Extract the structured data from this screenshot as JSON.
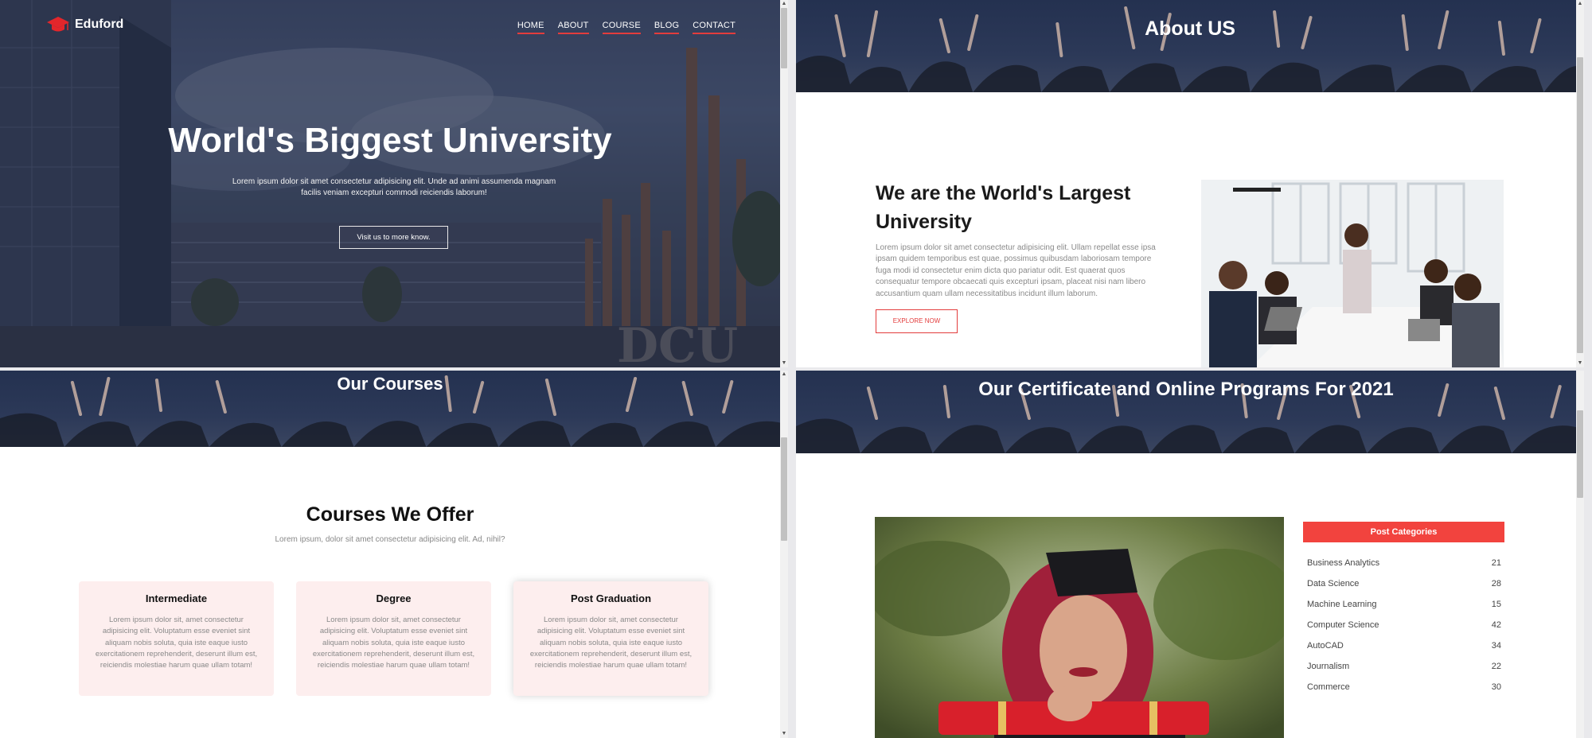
{
  "hero": {
    "brand": "Eduford",
    "nav": [
      "HOME",
      "ABOUT",
      "COURSE",
      "BLOG",
      "CONTACT"
    ],
    "title": "World's Biggest University",
    "text": "Lorem ipsum dolor sit amet consectetur adipisicing elit. Unde ad animi assumenda magnam facilis veniam excepturi commodi reiciendis laborum!",
    "button": "Visit us to more know."
  },
  "about": {
    "banner_title": "About US",
    "heading": "We are the World's Largest University",
    "paragraph": "Lorem ipsum dolor sit amet consectetur adipisicing elit. Ullam repellat esse ipsa ipsam quidem temporibus est quae, possimus quibusdam laboriosam tempore fuga modi id consectetur enim dicta quo pariatur odit. Est quaerat quos consequatur tempore obcaecati quis excepturi ipsam, placeat nisi nam libero accusantium quam ullam necessitatibus incidunt illum laborum.",
    "button": "EXPLORE NOW"
  },
  "courses": {
    "banner_title": "Our Courses",
    "heading": "Courses We Offer",
    "subtitle": "Lorem ipsum, dolor sit amet consectetur adipisicing elit. Ad, nihil?",
    "cards": [
      {
        "title": "Intermediate",
        "text": "Lorem ipsum dolor sit, amet consectetur adipisicing elit. Voluptatum esse eveniet sint aliquam nobis soluta, quia iste eaque iusto exercitationem reprehenderit, deserunt illum est, reiciendis molestiae harum quae ullam totam!"
      },
      {
        "title": "Degree",
        "text": "Lorem ipsum dolor sit, amet consectetur adipisicing elit. Voluptatum esse eveniet sint aliquam nobis soluta, quia iste eaque iusto exercitationem reprehenderit, deserunt illum est, reiciendis molestiae harum quae ullam totam!"
      },
      {
        "title": "Post Graduation",
        "text": "Lorem ipsum dolor sit, amet consectetur adipisicing elit. Voluptatum esse eveniet sint aliquam nobis soluta, quia iste eaque iusto exercitationem reprehenderit, deserunt illum est, reiciendis molestiae harum quae ullam totam!"
      }
    ]
  },
  "certificate": {
    "banner_title": "Our Certificate and Online Programs For 2021",
    "categories_title": "Post Categories",
    "categories": [
      {
        "name": "Business Analytics",
        "count": "21"
      },
      {
        "name": "Data Science",
        "count": "28"
      },
      {
        "name": "Machine Learning",
        "count": "15"
      },
      {
        "name": "Computer Science",
        "count": "42"
      },
      {
        "name": "AutoCAD",
        "count": "34"
      },
      {
        "name": "Journalism",
        "count": "22"
      },
      {
        "name": "Commerce",
        "count": "30"
      }
    ]
  },
  "colors": {
    "accent": "#f2433e",
    "banner": "#2c3958"
  }
}
